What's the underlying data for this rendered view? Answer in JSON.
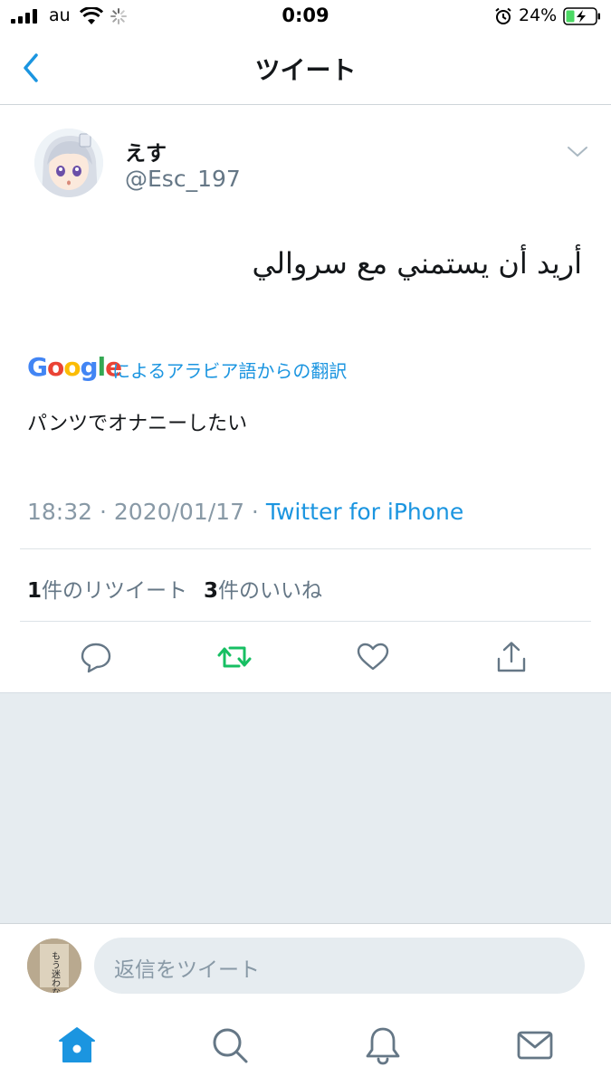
{
  "status_bar": {
    "carrier": "au",
    "time": "0:09",
    "battery": "24%"
  },
  "nav": {
    "title": "ツイート"
  },
  "tweet": {
    "display_name": "えす",
    "handle": "@Esc_197",
    "text": "أريد أن يستمني مع سروالي",
    "translation_provider": "Google",
    "translation_label": "によるアラビア語からの翻訳",
    "translated_text": "パンツでオナニーしたい",
    "time": "18:32",
    "date": "2020/01/17",
    "separator": " · ",
    "source": "Twitter for iPhone",
    "retweet_count": "1",
    "retweet_label": "件のリツイート",
    "like_count": "3",
    "like_label": "件のいいね"
  },
  "reply": {
    "placeholder": "返信をツイート",
    "avatar_text": "もう迷わない"
  },
  "colors": {
    "accent": "#1b95e0",
    "retweeted": "#17bf63",
    "icon_gray": "#657786"
  },
  "icons": {
    "actions": [
      "reply-icon",
      "retweet-icon",
      "like-icon",
      "share-icon"
    ],
    "tabs": [
      "home-icon",
      "search-icon",
      "notifications-icon",
      "messages-icon"
    ]
  }
}
